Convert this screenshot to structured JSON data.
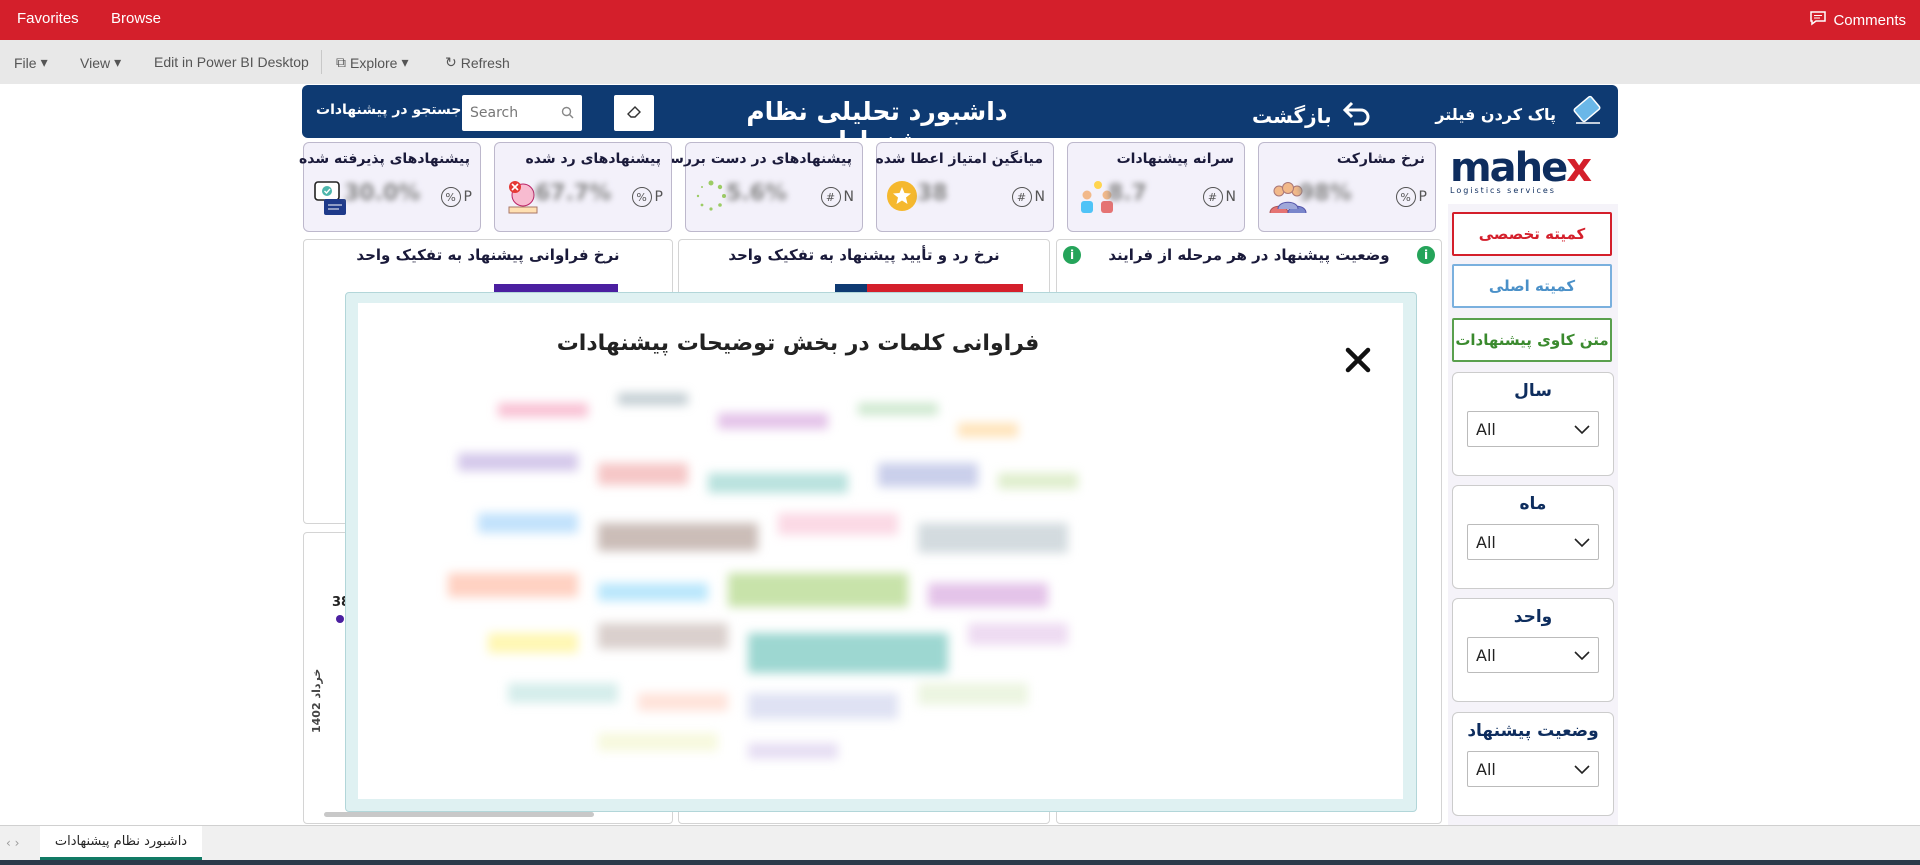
{
  "topbar": {
    "favorites": "Favorites",
    "browse": "Browse",
    "comments": "Comments"
  },
  "toolbar": {
    "file": "File",
    "view": "View",
    "edit_desktop": "Edit in Power BI Desktop",
    "explore": "Explore",
    "refresh": "Refresh"
  },
  "header": {
    "title": "داشبورد تحلیلی نظام پیشنهادات",
    "back": "بازگشت",
    "clear_filter": "پاک کردن فیلتر",
    "search_label": "جستجو در پیشنهادات",
    "search_placeholder": "Search"
  },
  "kpis": [
    {
      "title": "نرخ مشارکت",
      "value": "98%",
      "unit": "P",
      "badge": "%"
    },
    {
      "title": "سرانه پیشنهادات",
      "value": "8.7",
      "unit": "N",
      "badge": "#"
    },
    {
      "title": "میانگین امتیاز اعطا شده",
      "value": "38",
      "unit": "N",
      "badge": "#"
    },
    {
      "title": "پیشنهادهای در دست بررسی",
      "value": "5.6%",
      "unit": "N",
      "badge": "#"
    },
    {
      "title": "پیشنهادهای رد شده",
      "value": "67.7%",
      "unit": "P",
      "badge": "%"
    },
    {
      "title": "پیشنهادهای پذیرفته شده",
      "value": "30.0%",
      "unit": "P",
      "badge": "%"
    }
  ],
  "logo": {
    "brand_main": "mahe",
    "brand_accent": "x",
    "tagline": "Logistics services"
  },
  "sidebar": {
    "buttons": [
      {
        "label": "کمیته تخصصی",
        "color": "#d41f2b"
      },
      {
        "label": "کمیته اصلی",
        "color": "#4a90c8"
      },
      {
        "label": "متن کاوی پیشنهادات",
        "color": "#3a8a2e"
      }
    ],
    "slicers": [
      {
        "label": "سال",
        "value": "All"
      },
      {
        "label": "ماه",
        "value": "All"
      },
      {
        "label": "واحد",
        "value": "All"
      },
      {
        "label": "وضعیت پیشنهاد",
        "value": "All"
      }
    ]
  },
  "visuals": {
    "stage_status_title": "وضعیت پیشنهاد در هر مرحله از فرایند",
    "reject_rate_title": "نرخ رد و تأیید پیشنهاد به تفکیک واحد",
    "freq_rate_title": "نرخ فراوانی پیشنهاد به تفکیک واحد",
    "line_label": "38",
    "axis_label": "خرداد 1402"
  },
  "popup": {
    "title": "فراوانی کلمات در بخش توضیحات پیشنهادات"
  },
  "tabs": {
    "active": "داشبورد نظام پیشنهادات"
  },
  "colors": {
    "brand_red": "#d41f2b",
    "navy": "#0e3a72",
    "accent_purple": "#4b1fa0"
  }
}
